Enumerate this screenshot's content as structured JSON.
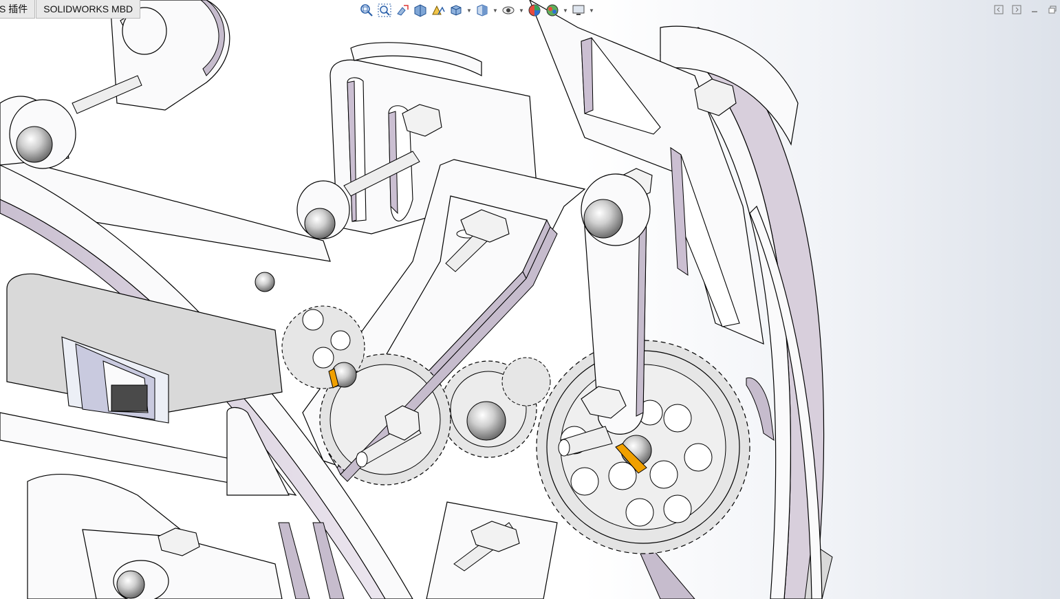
{
  "command_manager": {
    "tabs": [
      {
        "label": "S 插件"
      },
      {
        "label": "SOLIDWORKS MBD"
      }
    ]
  },
  "heads_up_toolbar": {
    "buttons": [
      {
        "icon": "zoom-to-fit-icon"
      },
      {
        "icon": "zoom-to-area-icon"
      },
      {
        "icon": "previous-view-icon"
      },
      {
        "icon": "section-view-icon"
      },
      {
        "icon": "dynamic-annotation-views-icon"
      },
      {
        "icon": "view-orientation-icon"
      },
      {
        "icon": "display-style-icon"
      },
      {
        "icon": "hide-show-items-icon"
      },
      {
        "icon": "edit-appearance-icon"
      },
      {
        "icon": "apply-scene-icon"
      },
      {
        "icon": "view-settings-icon"
      }
    ]
  },
  "window_controls": {
    "buttons": [
      {
        "icon": "tile-left-icon"
      },
      {
        "icon": "tile-right-icon"
      },
      {
        "icon": "minimize-icon"
      },
      {
        "icon": "restore-icon"
      }
    ]
  },
  "graphics_area": {
    "model_description": "",
    "colors": {
      "part_fill": "#fafafb",
      "part_shade": "#d6ccdb",
      "part_edge": "#000000",
      "gear_fill": "#e4e4e4",
      "orange_accent": "#f0a000",
      "background_right": "#dde2ea"
    }
  }
}
